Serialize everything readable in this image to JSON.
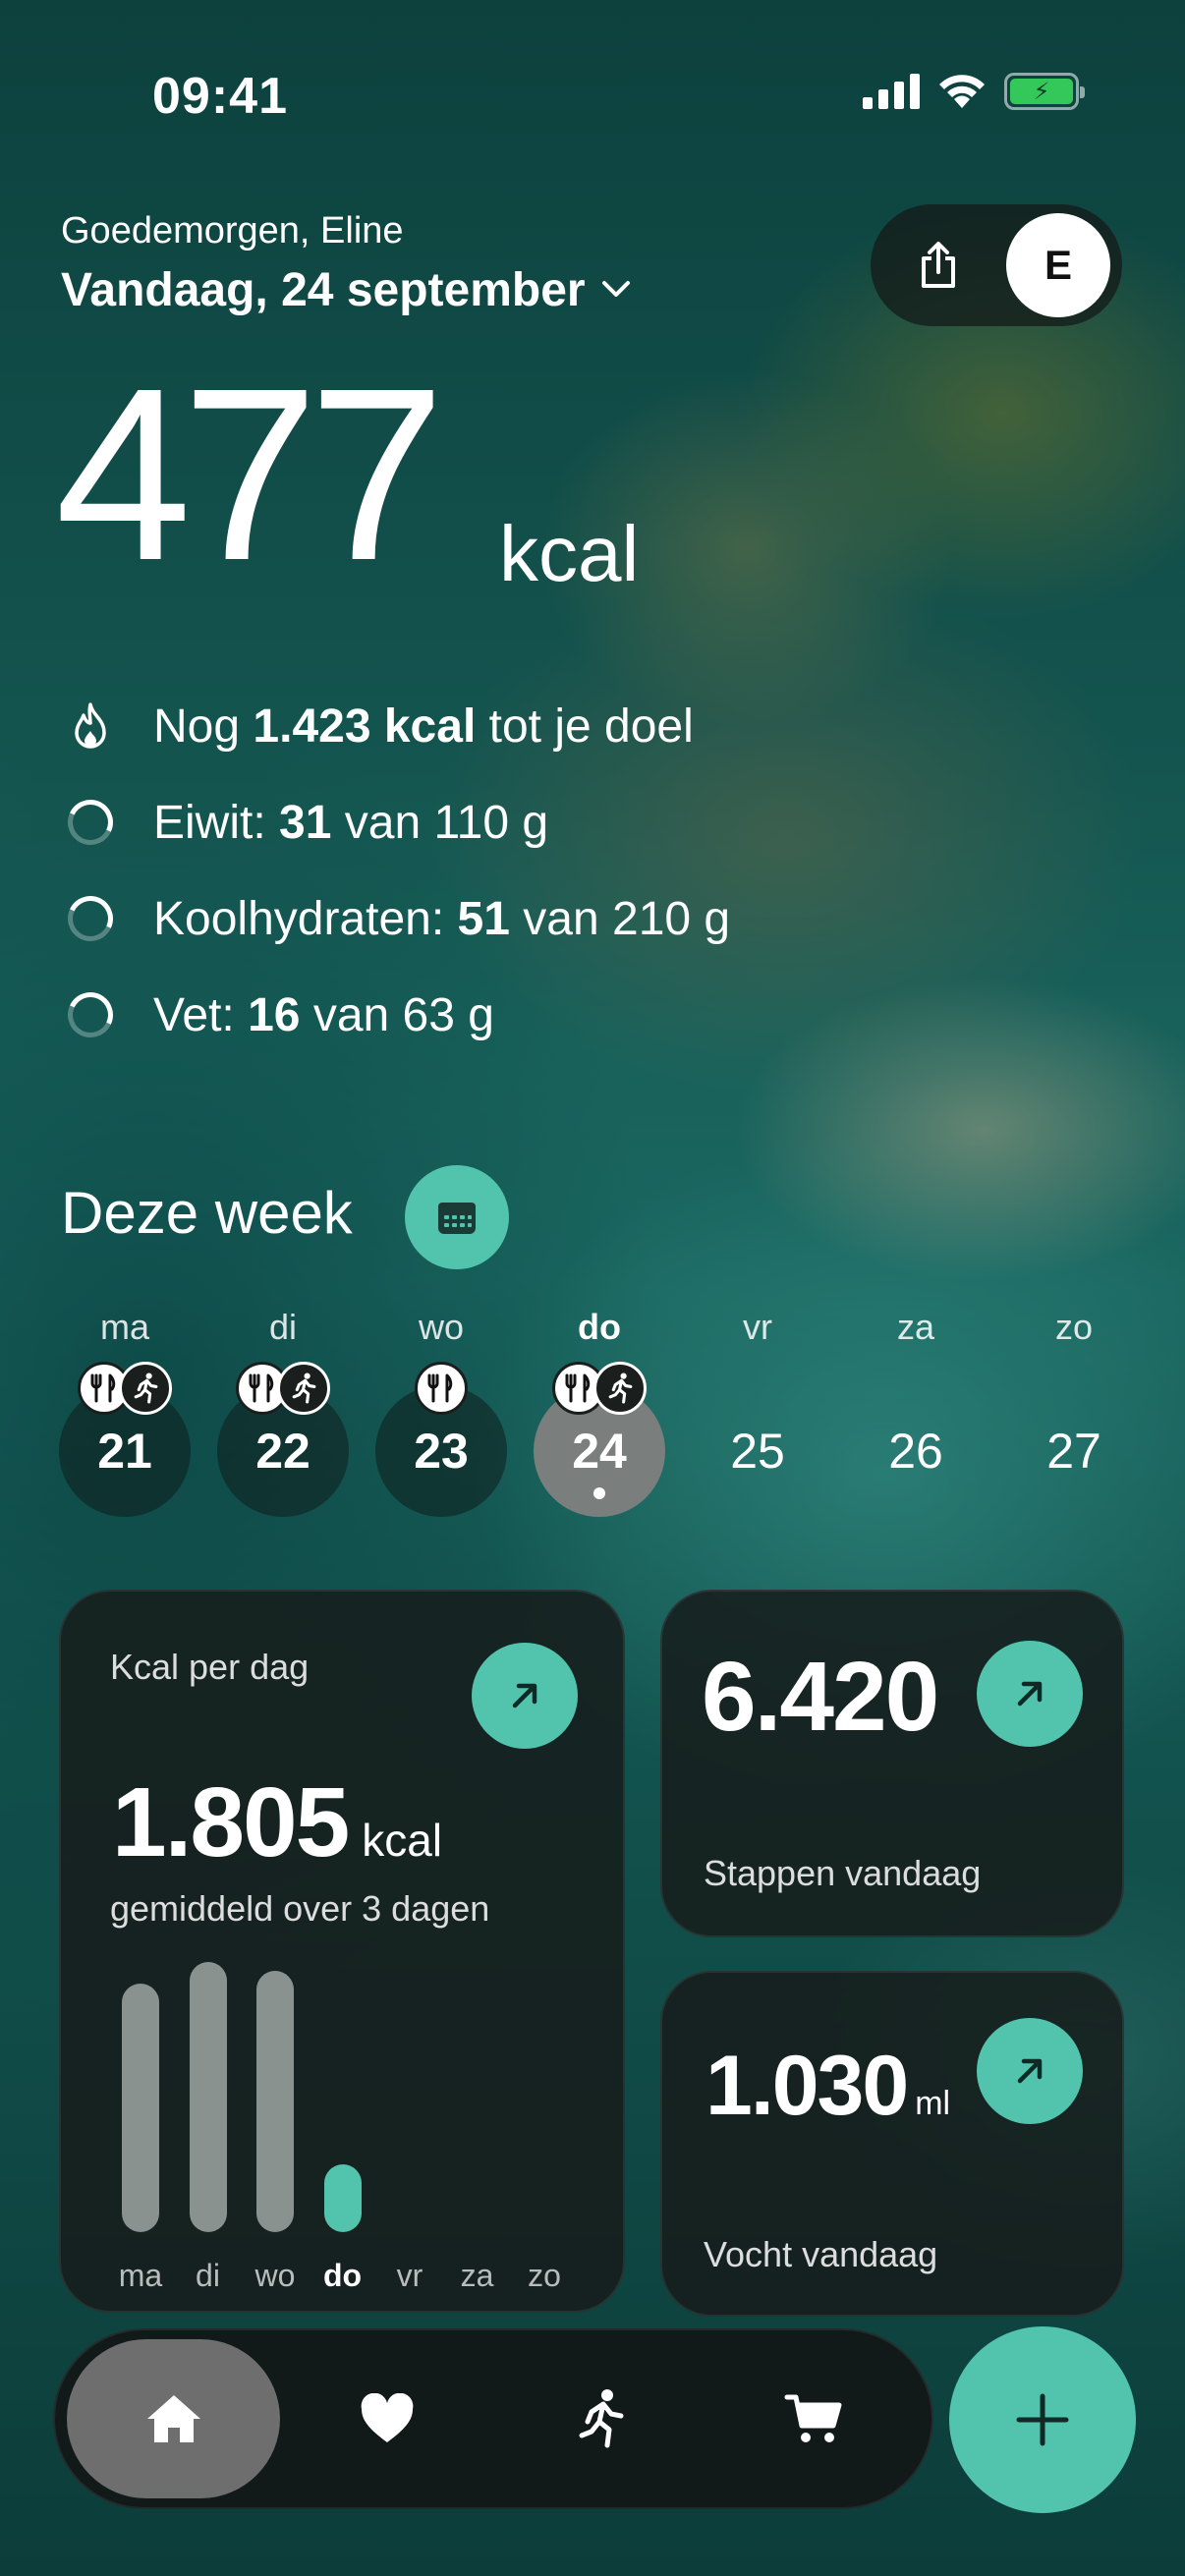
{
  "status_bar": {
    "time": "09:41"
  },
  "header": {
    "greeting": "Goedemorgen, Eline",
    "date": "Vandaag, 24 september",
    "avatar_initial": "E"
  },
  "summary": {
    "kcal_value": "477",
    "kcal_unit": "kcal",
    "remaining": {
      "prefix": "Nog ",
      "value": "1.423 kcal",
      "suffix": " tot je doel"
    },
    "protein": {
      "label": "Eiwit: ",
      "value": "31",
      "rest": " van 110 g",
      "progress": 0.28
    },
    "carbs": {
      "label": "Koolhydraten: ",
      "value": "51",
      "rest": " van 210 g",
      "progress": 0.24
    },
    "fat": {
      "label": "Vet: ",
      "value": "16",
      "rest": " van 63 g",
      "progress": 0.25
    }
  },
  "week": {
    "title": "Deze week",
    "days": [
      {
        "label": "ma",
        "date": "21",
        "meal": true,
        "activity": true,
        "state": "filled"
      },
      {
        "label": "di",
        "date": "22",
        "meal": true,
        "activity": true,
        "state": "filled"
      },
      {
        "label": "wo",
        "date": "23",
        "meal": true,
        "activity": false,
        "state": "filled"
      },
      {
        "label": "do",
        "date": "24",
        "meal": true,
        "activity": true,
        "state": "active"
      },
      {
        "label": "vr",
        "date": "25",
        "meal": false,
        "activity": false,
        "state": "empty"
      },
      {
        "label": "za",
        "date": "26",
        "meal": false,
        "activity": false,
        "state": "empty"
      },
      {
        "label": "zo",
        "date": "27",
        "meal": false,
        "activity": false,
        "state": "empty"
      }
    ]
  },
  "cards": {
    "kcal_per_day": {
      "title": "Kcal per dag",
      "average": "1.805",
      "unit": "kcal",
      "subtitle": "gemiddeld over 3 dagen"
    },
    "steps": {
      "value": "6.420",
      "caption": "Stappen vandaag"
    },
    "water": {
      "value": "1.030",
      "unit": "ml",
      "caption": "Vocht vandaag"
    }
  },
  "chart_data": {
    "type": "bar",
    "categories": [
      "ma",
      "di",
      "wo",
      "do",
      "vr",
      "za",
      "zo"
    ],
    "values": [
      1750,
      1900,
      1840,
      477,
      0,
      0,
      0
    ],
    "highlight": "do",
    "ylim": [
      0,
      1950
    ]
  },
  "colors": {
    "accent": "#52c4ad",
    "bar": "#8a928f",
    "card_bg": "#161c1b"
  },
  "nav": {
    "tabs": [
      {
        "name": "home-icon",
        "active": true
      },
      {
        "name": "heart-icon",
        "active": false
      },
      {
        "name": "running-icon",
        "active": false
      },
      {
        "name": "cart-icon",
        "active": false
      }
    ],
    "fab": "plus-icon"
  }
}
